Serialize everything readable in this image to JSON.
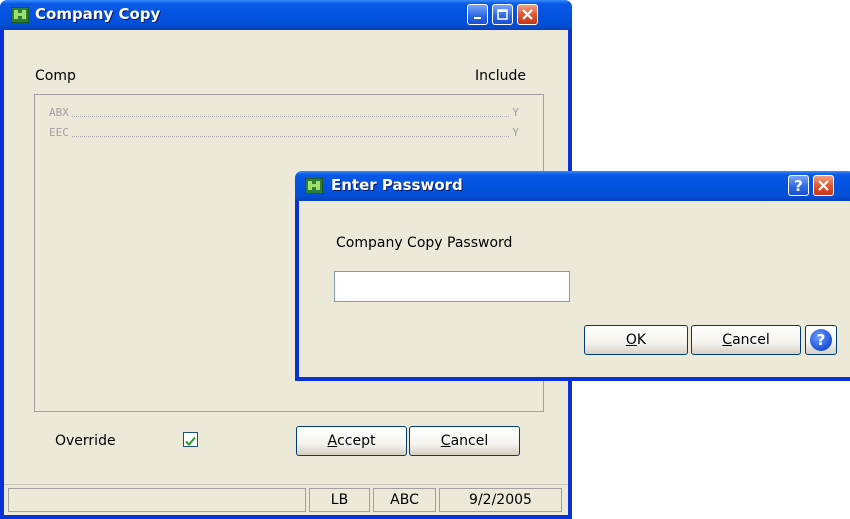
{
  "main_window": {
    "title": "Company Copy",
    "list": {
      "column_left": "Comp",
      "column_right": "Include",
      "rows": [
        {
          "code": "ABX",
          "include": "Y"
        },
        {
          "code": "EEC",
          "include": "Y"
        }
      ]
    },
    "override_label": "Override",
    "override_checked": true,
    "accept_button": {
      "pre": "",
      "mnemonic": "A",
      "post": "ccept"
    },
    "cancel_button": {
      "pre": "",
      "mnemonic": "C",
      "post": "ancel"
    },
    "status": {
      "panel1": "",
      "user": "LB",
      "company": "ABC",
      "date": "9/2/2005"
    }
  },
  "dialog": {
    "title": "Enter Password",
    "prompt": "Company Copy Password",
    "password_value": "",
    "ok_button": {
      "pre": "",
      "mnemonic": "O",
      "post": "K"
    },
    "cancel_button": {
      "pre": "",
      "mnemonic": "C",
      "post": "ancel"
    },
    "help_glyph": "?",
    "help_button_glyph": "?"
  },
  "colors": {
    "titlebar_blue": "#0554e3",
    "window_face": "#ece9d8",
    "check_green": "#21a121",
    "close_red": "#e0532c"
  }
}
